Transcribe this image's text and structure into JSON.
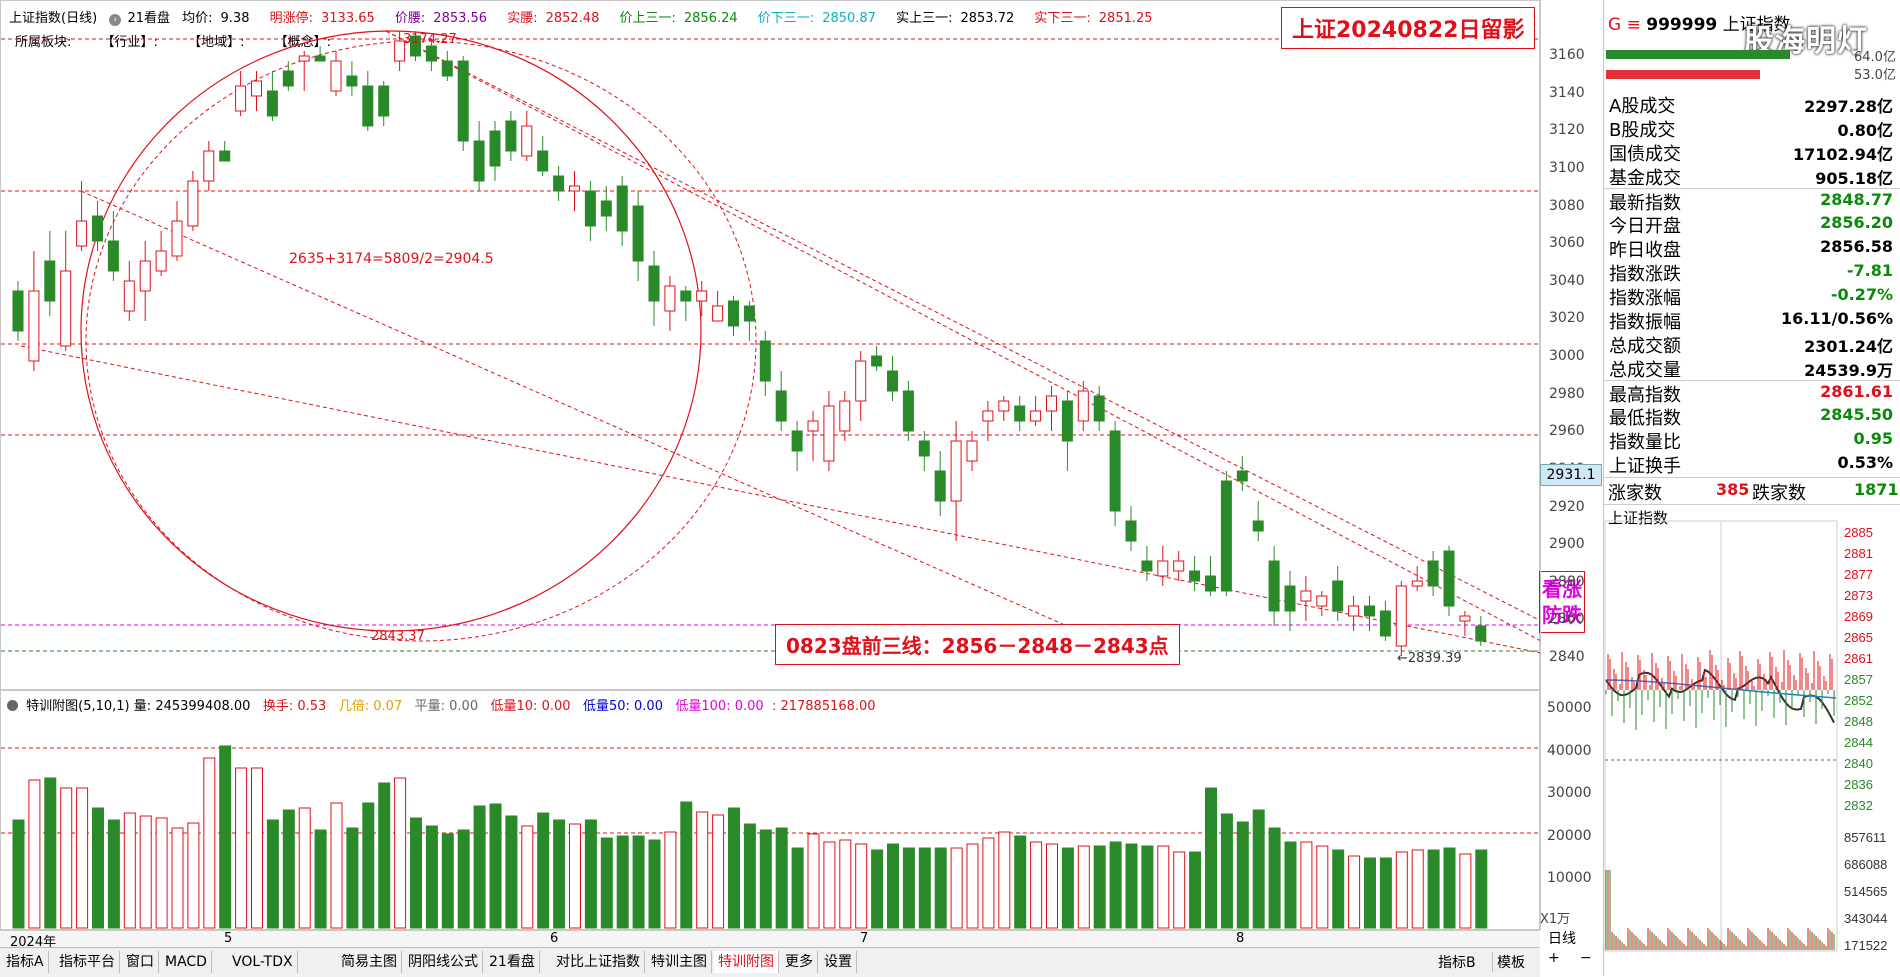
{
  "header": {
    "title": "上证指数(日线)",
    "period": "21看盘",
    "avg_label": "均价:",
    "avg_value": "9.38",
    "limit_up_label": "明涨停:",
    "limit_up_value": "3133.65",
    "waist_label": "价腰:",
    "waist_value": "2853.56",
    "real_waist_label": "实腰:",
    "real_waist_value": "2852.48",
    "upper3_label": "价上三一:",
    "upper3_value": "2856.24",
    "lower3_label": "价下三一:",
    "lower3_value": "2850.87",
    "real_upper3_label": "实上三一:",
    "real_upper3_value": "2853.72",
    "real_lower3_label": "实下三一:",
    "real_lower3_value": "2851.25"
  },
  "sectors": {
    "label": "所属板块:",
    "industry": "【行业】:",
    "region": "【地域】:",
    "concept": "【概念】:"
  },
  "notes": {
    "top_right": "上证20240822日留影",
    "bottom": "0823盘前三线：2856－2848－2843点",
    "side": "看涨防跌",
    "formula": "2635+3174=5809/2=2904.5",
    "peak": "3174.27",
    "low_mark": "2843.37",
    "last_low": "←2839.39",
    "price_box": "2931.1",
    "watermark": "股海明灯"
  },
  "yaxis_main": [
    "3160",
    "3140",
    "3120",
    "3100",
    "3080",
    "3060",
    "3040",
    "3020",
    "3000",
    "2980",
    "2960",
    "2940",
    "2920",
    "2900",
    "2880",
    "2860",
    "2840"
  ],
  "yaxis_vol": [
    "50000",
    "40000",
    "30000",
    "20000",
    "10000"
  ],
  "vol_unit": "X1万",
  "vol_header": {
    "name": "特训附图(5,10,1)",
    "vol_label": "量:",
    "vol_value": "245399408.00",
    "turnover_label": "换手:",
    "turnover_value": "0.53",
    "times_label": "几倍:",
    "times_value": "0.07",
    "flat_label": "平量:",
    "flat_value": "0.00",
    "low10_label": "低量10:",
    "low10_value": "0.00",
    "low50_label": "低量50:",
    "low50_value": "0.00",
    "low100_label": "低量100:",
    "low100_value": "0.00",
    "extra": ": 217885168.00"
  },
  "xaxis": {
    "year": "2024年",
    "m5": "5",
    "m6": "6",
    "m7": "7",
    "m8": "8"
  },
  "tabs": [
    "指标A",
    "指标平台",
    "窗口",
    "MACD",
    "VOL-TDX",
    "简易主图",
    "阴阳线公式",
    "21看盘",
    "对比上证指数",
    "特训主图",
    "特训附图",
    "更多",
    "设置"
  ],
  "tabs_right": [
    "指标B",
    "模板",
    "日线",
    "+",
    "−"
  ],
  "right_panel": {
    "code": "999999",
    "name": "上证指数",
    "g_icon": "G",
    "menu_icon": "≡",
    "bar_top_val": "64.0亿",
    "bar_bot_val": "53.0亿",
    "rows": [
      {
        "label": "A股成交",
        "value": "2297.28亿",
        "color": "black"
      },
      {
        "label": "B股成交",
        "value": "0.80亿",
        "color": "black"
      },
      {
        "label": "国债成交",
        "value": "17102.94亿",
        "color": "black"
      },
      {
        "label": "基金成交",
        "value": "905.18亿",
        "color": "black"
      },
      {
        "label": "最新指数",
        "value": "2848.77",
        "color": "green"
      },
      {
        "label": "今日开盘",
        "value": "2856.20",
        "color": "green"
      },
      {
        "label": "昨日收盘",
        "value": "2856.58",
        "color": "black"
      },
      {
        "label": "指数涨跌",
        "value": "-7.81",
        "color": "green"
      },
      {
        "label": "指数涨幅",
        "value": "-0.27%",
        "color": "green"
      },
      {
        "label": "指数振幅",
        "value": "16.11/0.56%",
        "color": "black"
      },
      {
        "label": "总成交额",
        "value": "2301.24亿",
        "color": "black"
      },
      {
        "label": "总成交量",
        "value": "24539.9万",
        "color": "black"
      },
      {
        "label": "最高指数",
        "value": "2861.61",
        "color": "red"
      },
      {
        "label": "最低指数",
        "value": "2845.50",
        "color": "green"
      },
      {
        "label": "指数量比",
        "value": "0.95",
        "color": "green"
      },
      {
        "label": "上证换手",
        "value": "0.53%",
        "color": "black"
      }
    ],
    "up_label": "涨家数",
    "up_value": "385",
    "down_label": "跌家数",
    "down_value": "1871",
    "mini_title": "上证指数",
    "mini_axis": [
      "2885",
      "2881",
      "2877",
      "2873",
      "2869",
      "2865",
      "2861",
      "2857",
      "2852",
      "2848",
      "2844",
      "2840",
      "2836",
      "2832"
    ],
    "mini_vol_axis": [
      "857611",
      "686088",
      "514565",
      "343044",
      "171522"
    ]
  },
  "colors": {
    "up": "#e0101a",
    "down": "#2a8a2a",
    "bg": "#ffffff",
    "accent": "#e000e0"
  }
}
